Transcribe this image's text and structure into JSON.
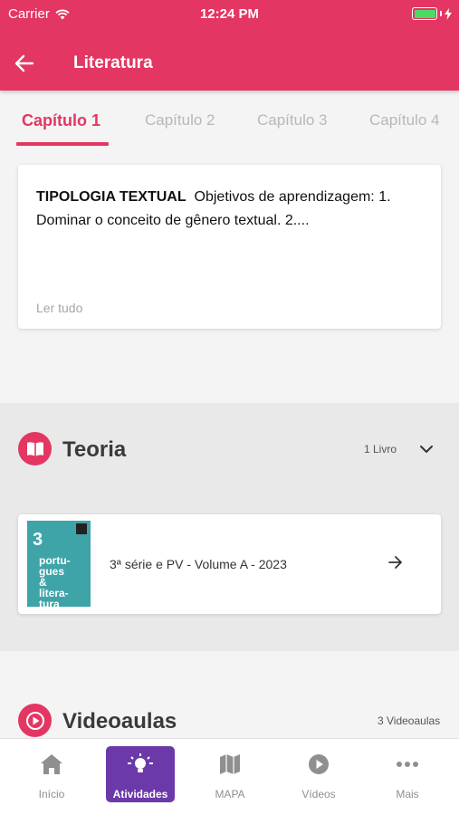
{
  "status_bar": {
    "carrier": "Carrier",
    "time": "12:24 PM"
  },
  "header": {
    "title": "Literatura",
    "back_icon": "arrow-left-icon"
  },
  "tabs": [
    {
      "label": "Capítulo 1",
      "active": true
    },
    {
      "label": "Capítulo 2",
      "active": false
    },
    {
      "label": "Capítulo 3",
      "active": false
    },
    {
      "label": "Capítulo 4",
      "active": false
    }
  ],
  "summary": {
    "heading": "TIPOLOGIA TEXTUAL",
    "text": "Objetivos de aprendizagem: 1. Dominar o conceito de gênero textual. 2....",
    "read_more": "Ler tudo"
  },
  "teoria": {
    "title": "Teoria",
    "count": "1 Livro",
    "book": {
      "title": "3ª série e PV - Volume A - 2023",
      "cover_number": "3",
      "cover_text": "portu-\ngues\n&\nlitera-\ntura"
    }
  },
  "videoaulas": {
    "title": "Videoaulas",
    "count": "3 Videoaulas"
  },
  "tabbar": [
    {
      "label": "Início",
      "icon": "home-icon",
      "active": false
    },
    {
      "label": "Atividades",
      "icon": "lightbulb-icon",
      "active": true
    },
    {
      "label": "MAPA",
      "icon": "map-icon",
      "active": false
    },
    {
      "label": "Vídeos",
      "icon": "play-circle-icon",
      "active": false
    },
    {
      "label": "Mais",
      "icon": "more-icon",
      "active": false
    }
  ],
  "colors": {
    "primary": "#e33662",
    "active_tab": "#6b39a8",
    "battery": "#4cd964"
  }
}
